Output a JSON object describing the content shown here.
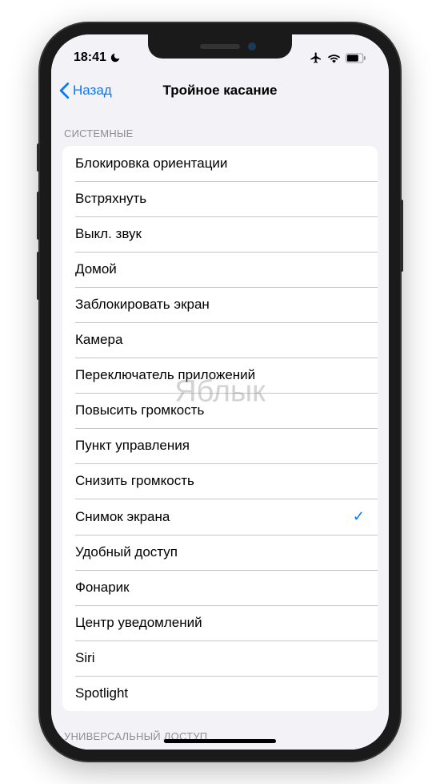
{
  "status": {
    "time": "18:41"
  },
  "nav": {
    "back": "Назад",
    "title": "Тройное касание"
  },
  "sections": {
    "system": {
      "header": "СИСТЕМНЫЕ",
      "items": [
        {
          "label": "Блокировка ориентации",
          "selected": false
        },
        {
          "label": "Встряхнуть",
          "selected": false
        },
        {
          "label": "Выкл. звук",
          "selected": false
        },
        {
          "label": "Домой",
          "selected": false
        },
        {
          "label": "Заблокировать экран",
          "selected": false
        },
        {
          "label": "Камера",
          "selected": false
        },
        {
          "label": "Переключатель приложений",
          "selected": false
        },
        {
          "label": "Повысить громкость",
          "selected": false
        },
        {
          "label": "Пункт управления",
          "selected": false
        },
        {
          "label": "Снизить громкость",
          "selected": false
        },
        {
          "label": "Снимок экрана",
          "selected": true
        },
        {
          "label": "Удобный доступ",
          "selected": false
        },
        {
          "label": "Фонарик",
          "selected": false
        },
        {
          "label": "Центр уведомлений",
          "selected": false
        },
        {
          "label": "Siri",
          "selected": false
        },
        {
          "label": "Spotlight",
          "selected": false
        }
      ]
    },
    "accessibility": {
      "header": "УНИВЕРСАЛЬНЫЙ ДОСТУП"
    }
  },
  "watermark": "Яблык"
}
